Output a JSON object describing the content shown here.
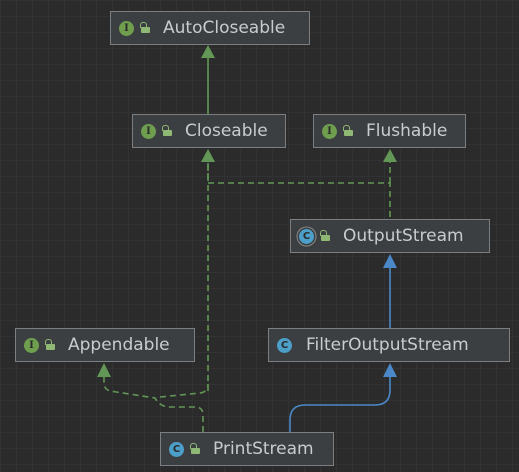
{
  "nodes": {
    "autocloseable": {
      "label": "AutoCloseable",
      "kind": "interface",
      "badge": "I"
    },
    "closeable": {
      "label": "Closeable",
      "kind": "interface",
      "badge": "I"
    },
    "flushable": {
      "label": "Flushable",
      "kind": "interface",
      "badge": "I"
    },
    "outputstream": {
      "label": "OutputStream",
      "kind": "abstract-class",
      "badge": "C"
    },
    "appendable": {
      "label": "Appendable",
      "kind": "interface",
      "badge": "I"
    },
    "filteroutputstream": {
      "label": "FilterOutputStream",
      "kind": "class",
      "badge": "C"
    },
    "printstream": {
      "label": "PrintStream",
      "kind": "class",
      "badge": "C"
    }
  },
  "edges": [
    {
      "from": "Closeable",
      "to": "AutoCloseable",
      "type": "extends"
    },
    {
      "from": "OutputStream",
      "to": "Closeable",
      "type": "implements"
    },
    {
      "from": "OutputStream",
      "to": "Flushable",
      "type": "implements"
    },
    {
      "from": "FilterOutputStream",
      "to": "OutputStream",
      "type": "extends"
    },
    {
      "from": "PrintStream",
      "to": "FilterOutputStream",
      "type": "extends"
    },
    {
      "from": "PrintStream",
      "to": "Appendable",
      "type": "implements"
    },
    {
      "from": "PrintStream",
      "to": "Closeable",
      "type": "implements"
    }
  ],
  "colors": {
    "background": "#2b2b2b",
    "node_fill": "#3c3f41",
    "node_border": "#7c7f82",
    "node_text": "#c9ccce",
    "interface_badge": "#6e9e4e",
    "class_badge": "#4c9fc9",
    "interface_edge": "#629755",
    "class_edge": "#4a88c7"
  }
}
